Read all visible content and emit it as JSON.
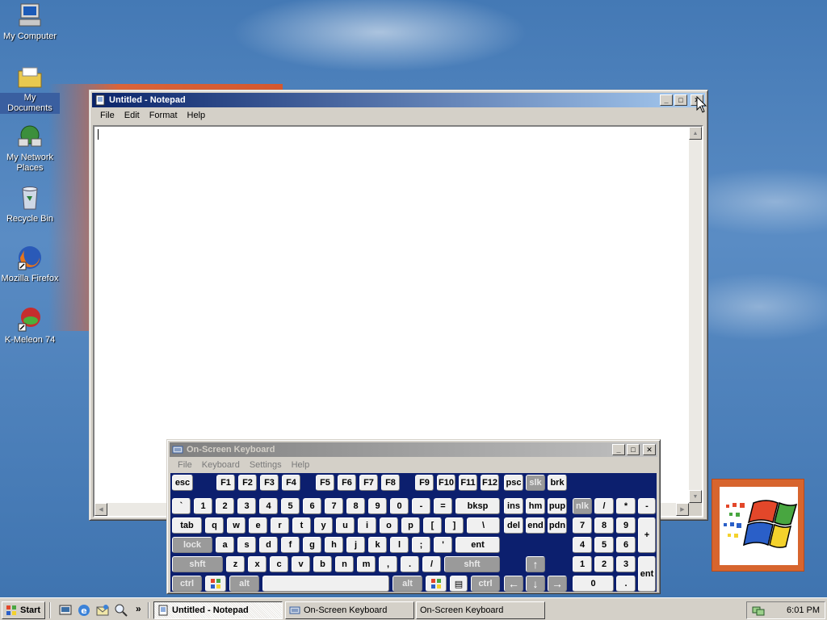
{
  "desktop": {
    "icons": [
      {
        "label": "My Computer",
        "icon": "computer-icon"
      },
      {
        "label": "My Documents",
        "icon": "folder-icon"
      },
      {
        "label": "My Network Places",
        "icon": "network-icon"
      },
      {
        "label": "Recycle Bin",
        "icon": "recycle-bin-icon"
      },
      {
        "label": "Mozilla Firefox",
        "icon": "firefox-icon"
      },
      {
        "label": "K-Meleon 74",
        "icon": "kmeleon-icon"
      }
    ]
  },
  "notepad": {
    "title": "Untitled - Notepad",
    "menu": [
      "File",
      "Edit",
      "Format",
      "Help"
    ],
    "content": ""
  },
  "osk": {
    "title": "On-Screen Keyboard",
    "menu": [
      "File",
      "Keyboard",
      "Settings",
      "Help"
    ],
    "keys": {
      "esc": "esc",
      "f": [
        "F1",
        "F2",
        "F3",
        "F4",
        "F5",
        "F6",
        "F7",
        "F8",
        "F9",
        "F10",
        "F11",
        "F12"
      ],
      "psc": "psc",
      "slk": "slk",
      "brk": "brk",
      "row1": [
        "`",
        "1",
        "2",
        "3",
        "4",
        "5",
        "6",
        "7",
        "8",
        "9",
        "0",
        "-",
        "="
      ],
      "bksp": "bksp",
      "ins": "ins",
      "hm": "hm",
      "pup": "pup",
      "nlk": "nlk",
      "div": "/",
      "mul": "*",
      "sub": "-",
      "tab": "tab",
      "row2": [
        "q",
        "w",
        "e",
        "r",
        "t",
        "y",
        "u",
        "i",
        "o",
        "p",
        "[",
        "]",
        "\\"
      ],
      "del": "del",
      "end": "end",
      "pdn": "pdn",
      "np789": [
        "7",
        "8",
        "9"
      ],
      "add": "+",
      "lock": "lock",
      "row3": [
        "a",
        "s",
        "d",
        "f",
        "g",
        "h",
        "j",
        "k",
        "l",
        ";",
        "'"
      ],
      "ent": "ent",
      "np456": [
        "4",
        "5",
        "6"
      ],
      "shft": "shft",
      "row4": [
        "z",
        "x",
        "c",
        "v",
        "b",
        "n",
        "m",
        ",",
        ".",
        "/"
      ],
      "np123": [
        "1",
        "2",
        "3"
      ],
      "npent": "ent",
      "ctrl": "ctrl",
      "alt": "alt",
      "np0": "0",
      "npdot": "."
    }
  },
  "taskbar": {
    "start": "Start",
    "tasks": [
      {
        "label": "Untitled - Notepad",
        "active": true
      },
      {
        "label": "On-Screen Keyboard",
        "active": false
      },
      {
        "label": "On-Screen Keyboard",
        "active": false
      }
    ],
    "chevron": "»",
    "clock": "6:01 PM"
  },
  "colors": {
    "desktop": "#3a6ea5",
    "title_active": "#0a246a",
    "osk_body": "#0c1f6e",
    "face": "#d4d0c8"
  }
}
